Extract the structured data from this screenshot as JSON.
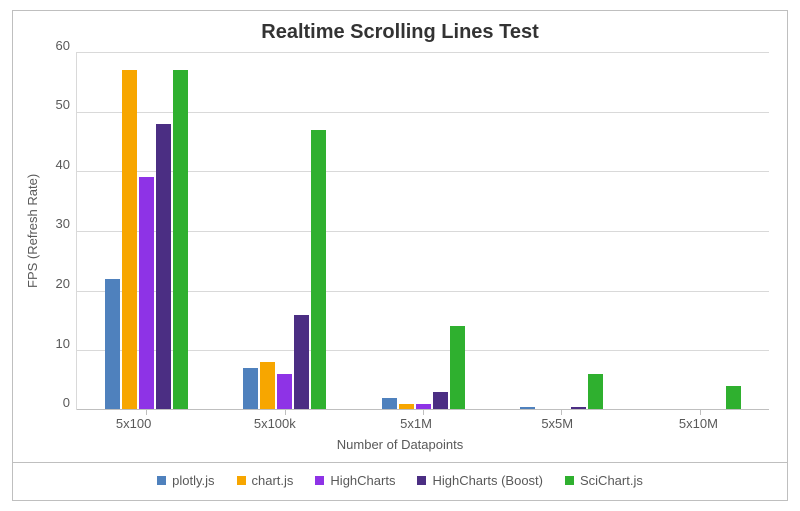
{
  "chart_data": {
    "type": "bar",
    "title": "Realtime Scrolling Lines Test",
    "xlabel": "Number of Datapoints",
    "ylabel": "FPS (Refresh Rate)",
    "ylim": [
      0,
      60
    ],
    "ystep": 10,
    "categories": [
      "5x100",
      "5x100k",
      "5x1M",
      "5x5M",
      "5x10M"
    ],
    "series": [
      {
        "name": "plotly.js",
        "color": "#4f81bd",
        "values": [
          22,
          7,
          2,
          0.5,
          0
        ]
      },
      {
        "name": "chart.js",
        "color": "#f7a600",
        "values": [
          57,
          8,
          1,
          0,
          0
        ]
      },
      {
        "name": "HighCharts",
        "color": "#8e33e6",
        "values": [
          39,
          6,
          1,
          0,
          0
        ]
      },
      {
        "name": "HighCharts (Boost)",
        "color": "#4b2e83",
        "values": [
          48,
          16,
          3,
          0.5,
          0
        ]
      },
      {
        "name": "SciChart.js",
        "color": "#2fb02f",
        "values": [
          57,
          47,
          14,
          6,
          4
        ]
      }
    ]
  }
}
